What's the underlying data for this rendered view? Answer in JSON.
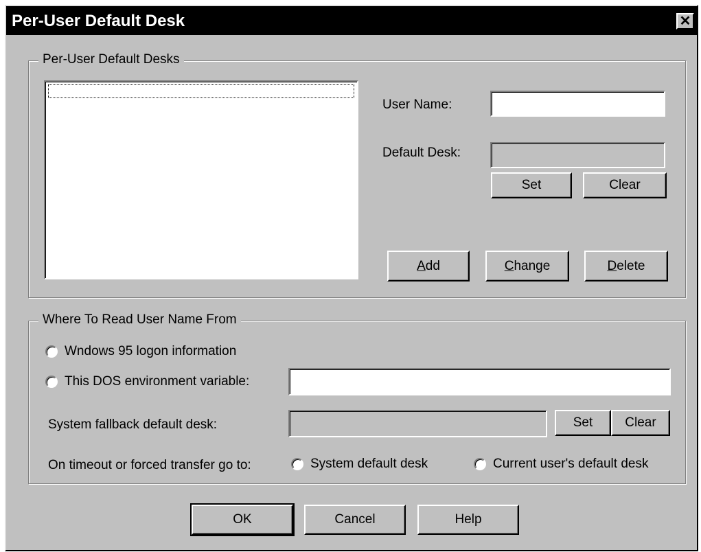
{
  "window": {
    "title": "Per-User Default Desk",
    "close_glyph": "✕"
  },
  "group_desks": {
    "label": "Per-User Default Desks",
    "user_name_label": "User Name:",
    "user_name_value": "",
    "default_desk_label": "Default Desk:",
    "default_desk_value": "",
    "set_label": "Set",
    "clear_label": "Clear",
    "add_underline": "A",
    "add_rest": "dd",
    "change_underline": "C",
    "change_rest": "hange",
    "delete_underline": "D",
    "delete_rest": "elete"
  },
  "group_read": {
    "label": "Where To Read User Name From",
    "radio_win95": "Wndows 95 logon information",
    "radio_dos": "This DOS environment variable:",
    "dos_value": "",
    "fallback_label": "System fallback default desk:",
    "fallback_value": "",
    "set_label": "Set",
    "clear_label": "Clear",
    "timeout_label": "On timeout or forced transfer go to:",
    "radio_system": "System default desk",
    "radio_current": "Current user's default desk"
  },
  "footer": {
    "ok_label": "OK",
    "cancel_label": "Cancel",
    "help_label": "Help"
  }
}
